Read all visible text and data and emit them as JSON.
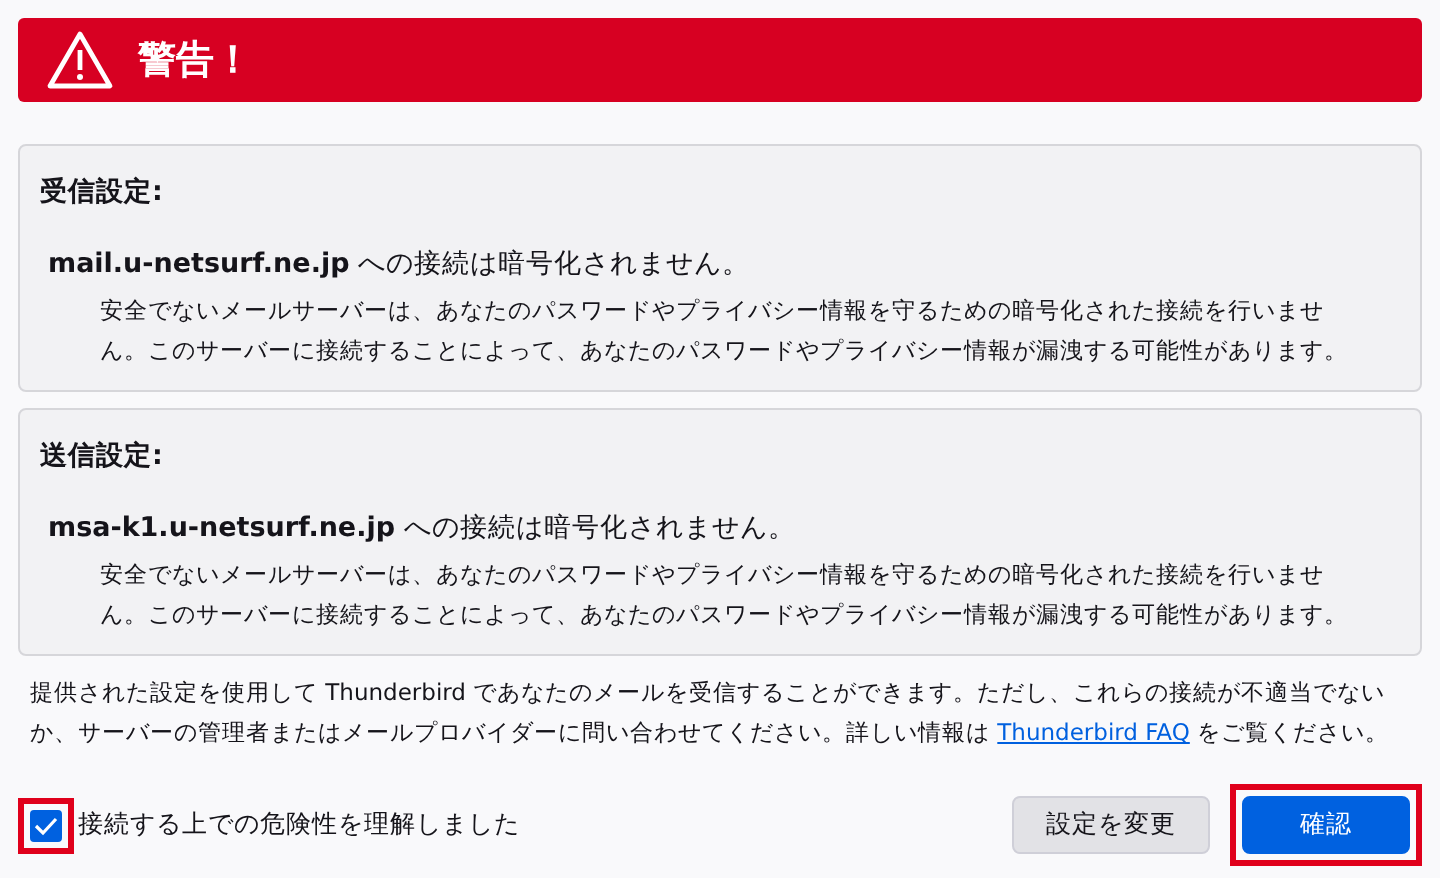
{
  "header": {
    "title": "警告！"
  },
  "sections": [
    {
      "heading": "受信設定:",
      "message": "**mail.u-netsurf.ne.jp** への接続は暗号化されません。",
      "detail": "安全でないメールサーバーは、あなたのパスワードやプライバシー情報を守るための暗号化された接続を行いません。このサーバーに接続することによって、あなたのパスワードやプライバシー情報が漏洩する可能性があります。"
    },
    {
      "heading": "送信設定:",
      "message": "**msa-k1.u-netsurf.ne.jp** への接続は暗号化されません。",
      "detail": "安全でないメールサーバーは、あなたのパスワードやプライバシー情報を守るための暗号化された接続を行いません。このサーバーに接続することによって、あなたのパスワードやプライバシー情報が漏洩する可能性があります。"
    }
  ],
  "note": {
    "text": "提供された設定を使用して Thunderbird であなたのメールを受信することができます。ただし、これらの接続が不適当でないか、サーバーの管理者またはメールプロバイダーに問い合わせてください。詳しい情報は",
    "link": "Thunderbird FAQ",
    "suffix": "をご覧ください。"
  },
  "acknowledge": {
    "label": "接続する上での危険性を理解しました",
    "checked": true,
    "highlighted": true
  },
  "buttons": [
    {
      "label": "設定を変更",
      "kind": "secondary",
      "highlighted": false
    },
    {
      "label": "確認",
      "kind": "primary",
      "highlighted": true
    }
  ]
}
